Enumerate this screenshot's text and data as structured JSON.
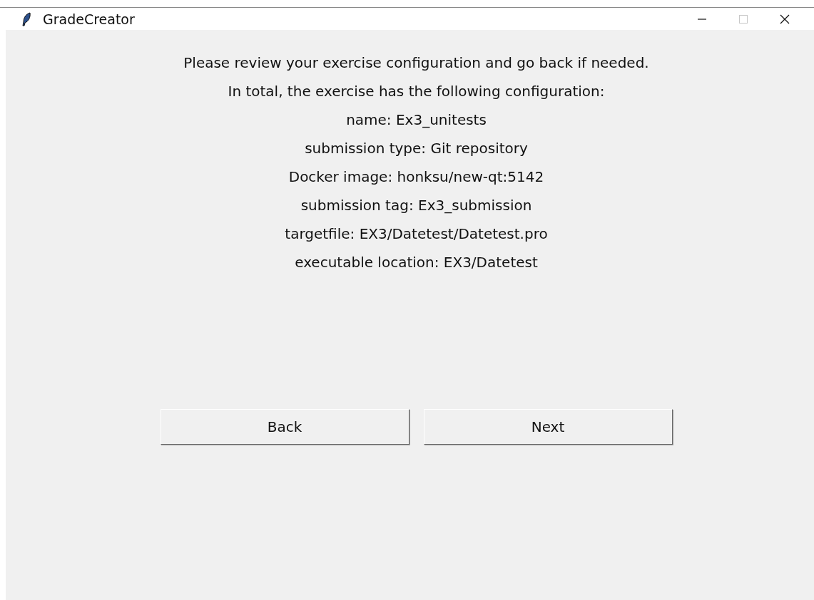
{
  "window": {
    "title": "GradeCreator"
  },
  "lines": [
    "Please review your exercise configuration and go back if needed.",
    "In total, the exercise has the following configuration:",
    "name: Ex3_unitests",
    "submission type: Git repository",
    "Docker image: honksu/new-qt:5142",
    "submission tag: Ex3_submission",
    "targetfile: EX3/Datetest/Datetest.pro",
    "executable location: EX3/Datetest"
  ],
  "buttons": [
    "Back",
    "Next"
  ]
}
